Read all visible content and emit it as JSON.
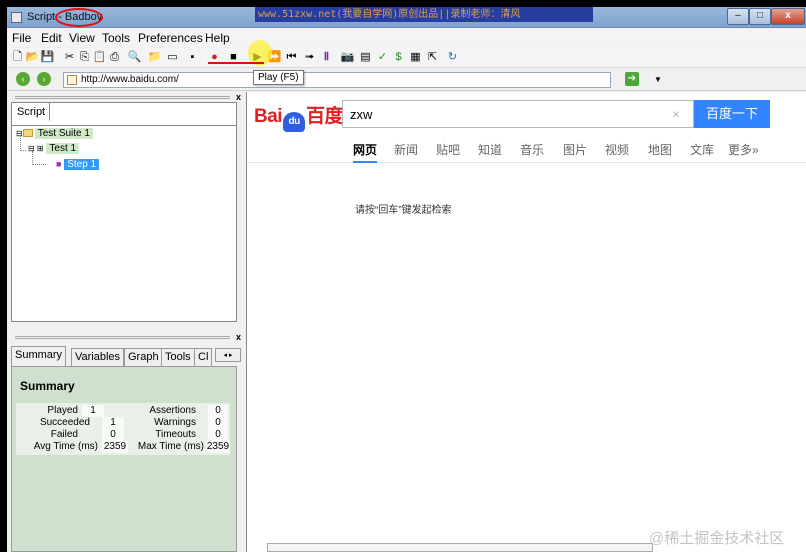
{
  "window": {
    "title_prefix": "Script - ",
    "title_app": "Badboy",
    "banner": "www.51zxw.net(我要自学网)原创出品||录制老师：清风",
    "buttons": {
      "minimize": "–",
      "maximize": "□",
      "close": "x"
    }
  },
  "menu": [
    "File",
    "Edit",
    "View",
    "Tools",
    "Preferences",
    "Help"
  ],
  "toolbar": {
    "icons": [
      "new-icon",
      "open-icon",
      "save-icon",
      "cut-icon",
      "copy-icon",
      "paste-icon",
      "print-icon",
      "find-icon",
      "add-suite-icon",
      "add-test-icon",
      "add-step-icon",
      "record-icon",
      "stop-icon",
      "play-icon",
      "play-all-icon",
      "rewind-icon",
      "step-forward-icon",
      "pause-icon",
      "screenshot-icon",
      "form-icon",
      "checkmark-icon",
      "dollar-icon",
      "report-icon",
      "export-icon",
      "refresh-icon"
    ],
    "glyphs": [
      "🗋",
      "📂",
      "💾",
      "✂",
      "⎘",
      "📋",
      "⎙",
      "🔍",
      "📁",
      "▭",
      "▪",
      "●",
      "■",
      "▶",
      "⏩",
      "⏮",
      "➟",
      "Ⅱ",
      "📷",
      "▤",
      "✓",
      "$",
      "▦",
      "⇱",
      "↻"
    ],
    "tooltip": "Play (F5)"
  },
  "address": {
    "url": "http://www.baidu.com/",
    "back": "‹",
    "forward": "›",
    "go": "➔",
    "dropdown": "▼"
  },
  "script_panel": {
    "tab": "Script",
    "tree": {
      "suite": "Test Suite 1",
      "test": "Test 1",
      "step": "Step 1"
    },
    "close": "x"
  },
  "summary_panel": {
    "tabs": [
      "Summary",
      "Variables",
      "Graph",
      "Tools",
      "Cl"
    ],
    "scroll": "◂ ▸",
    "title": "Summary",
    "rows": [
      {
        "l1": "Played",
        "v1": "1",
        "l2": "Assertions",
        "v2": "0"
      },
      {
        "l1": "Succeeded",
        "v1": "1",
        "l2": "Warnings",
        "v2": "0"
      },
      {
        "l1": "Failed",
        "v1": "0",
        "l2": "Timeouts",
        "v2": "0"
      },
      {
        "l1": "Avg Time (ms)",
        "v1": "2359",
        "l2": "Max Time (ms)",
        "v2": "2359"
      }
    ],
    "close": "x"
  },
  "browser": {
    "logo_left": "Bai",
    "logo_du": "du",
    "logo_right": "百度",
    "search_value": "zxw",
    "search_clear": "×",
    "search_button": "百度一下",
    "nav": [
      "网页",
      "新闻",
      "贴吧",
      "知道",
      "音乐",
      "图片",
      "视频",
      "地图",
      "文库",
      "更多»"
    ],
    "hint": "请按“回车”键发起检索"
  },
  "watermark": "@稀土掘金技术社区",
  "colors": {
    "accent": "#3385ff",
    "record": "#e02020",
    "tree_highlight": "#3399ff",
    "summary_bg": "#cfe0cf"
  }
}
